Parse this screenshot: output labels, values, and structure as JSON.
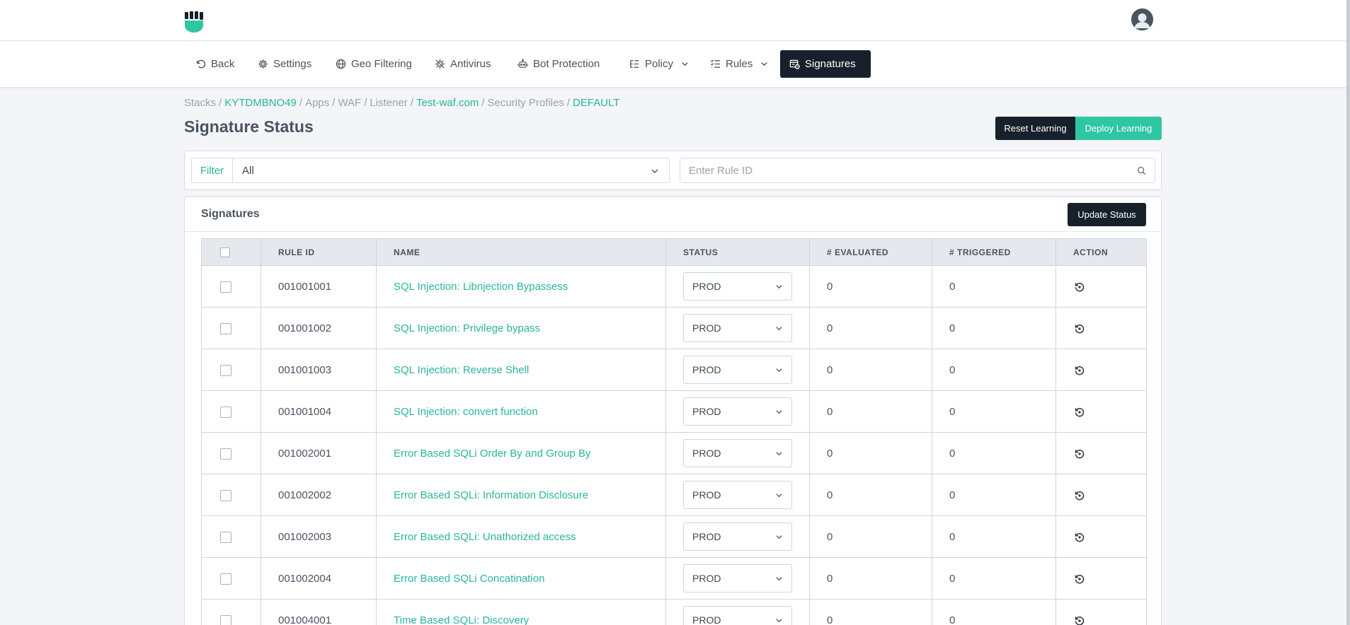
{
  "nav": {
    "back": "Back",
    "settings": "Settings",
    "geo_filtering": "Geo Filtering",
    "antivirus": "Antivirus",
    "bot_protection": "Bot Protection",
    "policy": "Policy",
    "rules": "Rules",
    "signatures": "Signatures"
  },
  "breadcrumb": {
    "stacks": "Stacks",
    "stack_id": "KYTDMBNO49",
    "apps": "Apps",
    "waf": "WAF",
    "listener": "Listener",
    "domain": "Test-waf.com",
    "security_profiles": "Security Profiles",
    "profile": "DEFAULT"
  },
  "page": {
    "title": "Signature Status",
    "reset_label": "Reset Learning",
    "deploy_label": "Deploy Learning"
  },
  "filter": {
    "label": "Filter",
    "selected": "All",
    "search_placeholder": "Enter Rule ID"
  },
  "signatures": {
    "title": "Signatures",
    "update_label": "Update Status",
    "columns": [
      "RULE ID",
      "NAME",
      "STATUS",
      "# EVALUATED",
      "# TRIGGERED",
      "ACTION"
    ],
    "rows": [
      {
        "rule_id": "001001001",
        "name": "SQL Injection: Libnjection Bypassess",
        "status": "PROD",
        "evaluated": "0",
        "triggered": "0"
      },
      {
        "rule_id": "001001002",
        "name": "SQL Injection: Privilege bypass",
        "status": "PROD",
        "evaluated": "0",
        "triggered": "0"
      },
      {
        "rule_id": "001001003",
        "name": "SQL Injection: Reverse Shell",
        "status": "PROD",
        "evaluated": "0",
        "triggered": "0"
      },
      {
        "rule_id": "001001004",
        "name": "SQL Injection: convert function",
        "status": "PROD",
        "evaluated": "0",
        "triggered": "0"
      },
      {
        "rule_id": "001002001",
        "name": "Error Based SQLi Order By and Group By",
        "status": "PROD",
        "evaluated": "0",
        "triggered": "0"
      },
      {
        "rule_id": "001002002",
        "name": "Error Based SQLi: Information Disclosure",
        "status": "PROD",
        "evaluated": "0",
        "triggered": "0"
      },
      {
        "rule_id": "001002003",
        "name": "Error Based SQLi: Unathorized access",
        "status": "PROD",
        "evaluated": "0",
        "triggered": "0"
      },
      {
        "rule_id": "001002004",
        "name": "Error Based SQLi Concatination",
        "status": "PROD",
        "evaluated": "0",
        "triggered": "0"
      },
      {
        "rule_id": "001004001",
        "name": "Time Based SQLi: Discovery",
        "status": "PROD",
        "evaluated": "0",
        "triggered": "0"
      }
    ]
  },
  "colors": {
    "accent": "#2ec7a2",
    "link": "#2ab59a",
    "dark": "#17212b"
  },
  "icons": {
    "logo": "shield-fist-logo",
    "avatar": "user-avatar-icon",
    "action": "reset-status-icon"
  }
}
